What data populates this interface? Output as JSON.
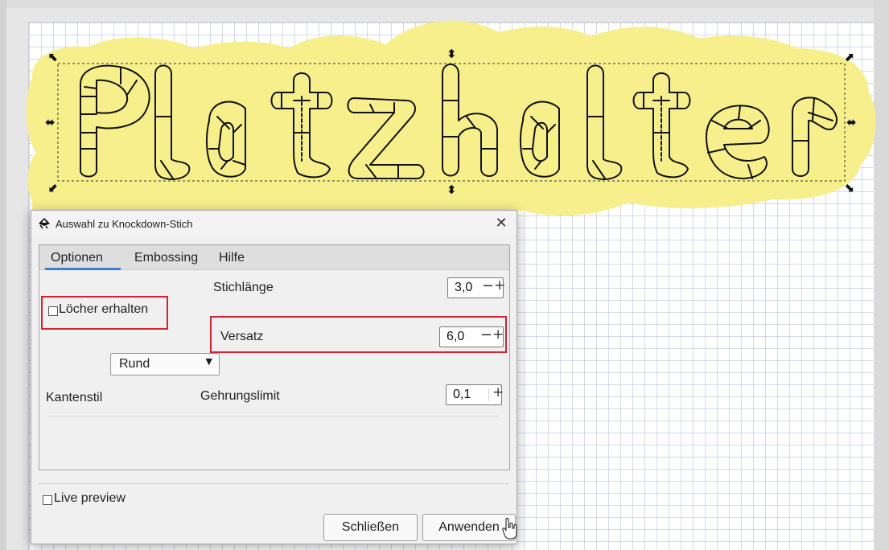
{
  "canvas": {
    "artwork_text": "Platzhalter",
    "highlight_color": "#f6ef8c"
  },
  "dialog": {
    "title": "Auswahl zu Knockdown-Stich",
    "close_icon": "close-icon",
    "tabs": [
      {
        "label": "Optionen",
        "active": true
      },
      {
        "label": "Embossing",
        "active": false
      },
      {
        "label": "Hilfe",
        "active": false
      }
    ],
    "fields": {
      "stichlaenge": {
        "label": "Stichlänge",
        "value": "3,0"
      },
      "loecher": {
        "label": "Löcher erhalten",
        "checked": false
      },
      "versatz": {
        "label": "Versatz",
        "value": "6,0"
      },
      "kantenstil": {
        "label": "Kantenstil",
        "value": "Rund"
      },
      "gehrungslimit": {
        "label": "Gehrungslimit",
        "value": "0,1"
      }
    },
    "live_preview": {
      "label": "Live preview",
      "checked": false
    },
    "buttons": {
      "close": "Schließen",
      "apply": "Anwenden"
    },
    "highlight_color": "#d0252f"
  }
}
